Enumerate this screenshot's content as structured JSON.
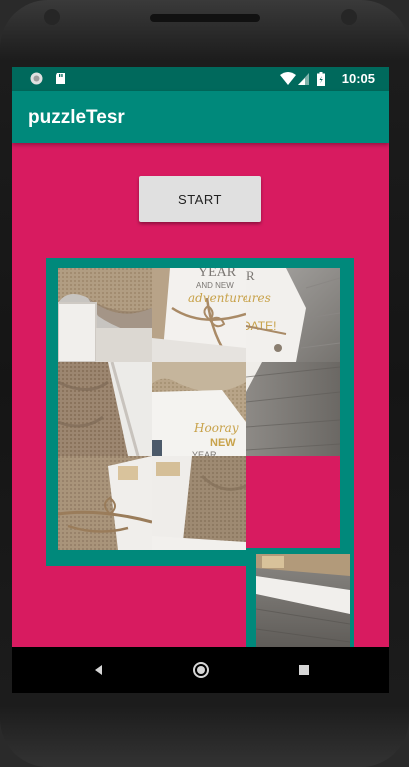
{
  "status_bar": {
    "time": "10:05",
    "icons": [
      "circle-notification-icon",
      "sd-card-icon",
      "wifi-icon",
      "signal-icon",
      "battery-icon"
    ]
  },
  "app_bar": {
    "title": "puzzleTesr"
  },
  "controls": {
    "start_label": "START"
  },
  "puzzle": {
    "grid_size": "3x3",
    "tiles": [
      {
        "id": "tile-r1c1",
        "content": "burlap-and-paper"
      },
      {
        "id": "tile-r1c2",
        "content": "card-with-string"
      },
      {
        "id": "tile-r1c3",
        "content": "card-corner-wood"
      },
      {
        "id": "tile-r2c1",
        "content": "box-edge-burlap"
      },
      {
        "id": "tile-r2c2",
        "content": "hooray-card"
      },
      {
        "id": "tile-r2c3",
        "content": "wood-surface"
      },
      {
        "id": "tile-r3c1",
        "content": "burlap-twine"
      },
      {
        "id": "tile-r3c2",
        "content": "box-interior"
      },
      {
        "id": "tile-r4c3",
        "content": "box-corner-wood"
      }
    ]
  },
  "nav_bar": {
    "buttons": [
      "back-icon",
      "home-icon",
      "recents-icon"
    ]
  },
  "colors": {
    "status_bar": "#00695c",
    "app_bar": "#00897b",
    "background": "#d81b60",
    "board": "#00897b",
    "button": "#e0e0e0"
  }
}
